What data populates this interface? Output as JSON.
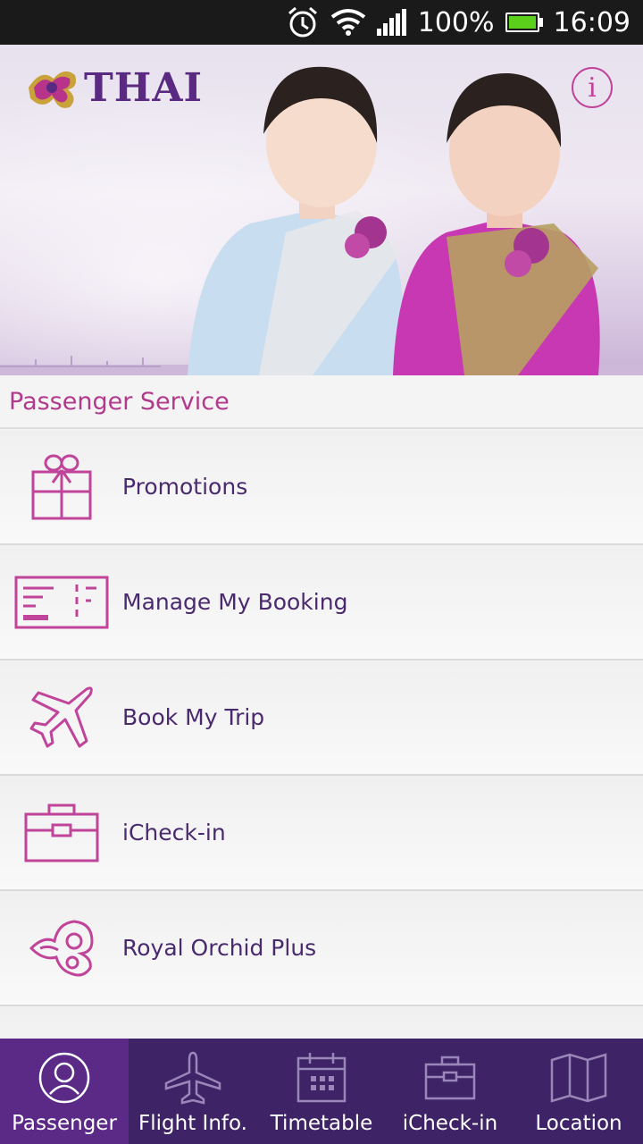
{
  "status_bar": {
    "battery_text": "100%",
    "time": "16:09",
    "battery_color": "#5cd11b"
  },
  "hero": {
    "logo_text": "THAI",
    "info_label": "i"
  },
  "section": {
    "title": "Passenger Service"
  },
  "menu": {
    "items": [
      {
        "label": "Promotions",
        "icon": "gift-icon"
      },
      {
        "label": "Manage My Booking",
        "icon": "ticket-icon"
      },
      {
        "label": "Book My Trip",
        "icon": "airplane-icon"
      },
      {
        "label": "iCheck-in",
        "icon": "briefcase-icon"
      },
      {
        "label": "Royal Orchid Plus",
        "icon": "orchid-icon"
      }
    ]
  },
  "bottom_nav": {
    "items": [
      {
        "label": "Passenger",
        "icon": "person-icon",
        "active": true
      },
      {
        "label": "Flight Info.",
        "icon": "airplane-icon",
        "active": false
      },
      {
        "label": "Timetable",
        "icon": "calendar-icon",
        "active": false
      },
      {
        "label": "iCheck-in",
        "icon": "briefcase-icon",
        "active": false
      },
      {
        "label": "Location",
        "icon": "map-icon",
        "active": false
      }
    ]
  },
  "colors": {
    "accent": "#b23a8c",
    "brand_purple": "#5a2a82",
    "nav_background": "#3e2466",
    "nav_active": "#5b2a86"
  }
}
